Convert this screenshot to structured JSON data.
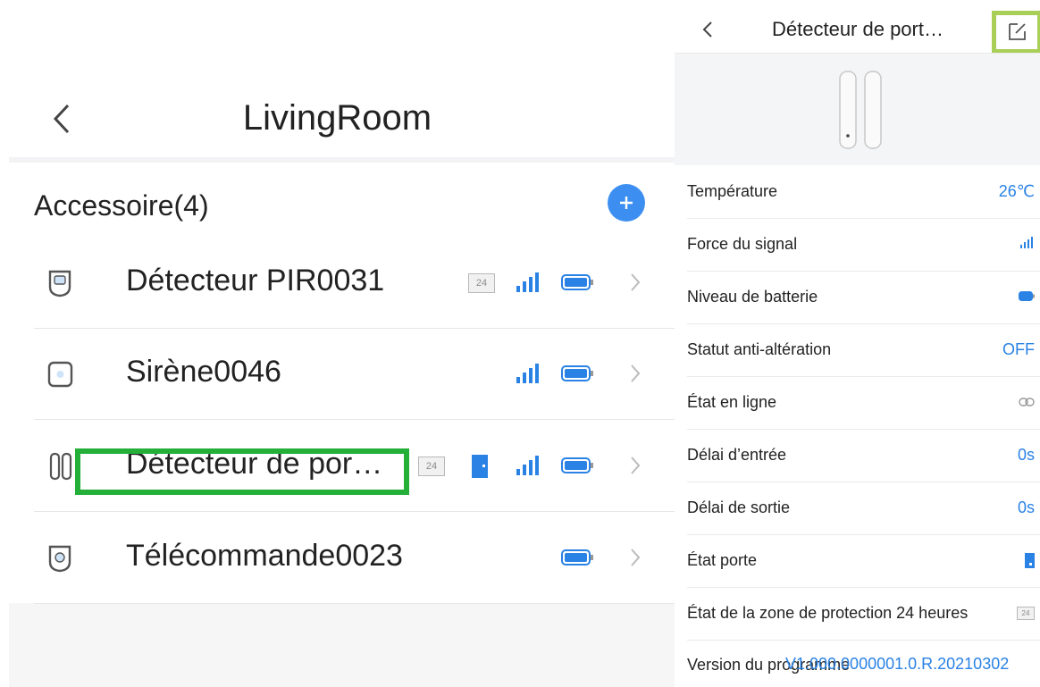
{
  "left": {
    "title": "LivingRoom",
    "section_title": "Accessoire(4)",
    "add_label": "+",
    "devices": [
      {
        "name": "Détecteur PIR0031",
        "icon": "pir-sensor-icon",
        "badge": "24",
        "signal": true,
        "battery": true
      },
      {
        "name": "Sirène0046",
        "icon": "siren-icon",
        "signal": true,
        "battery": true
      },
      {
        "name": "Détecteur de por…",
        "icon": "door-sensor-icon",
        "badge": "24",
        "door": true,
        "signal": true,
        "battery": true
      },
      {
        "name": "Télécommande0023",
        "icon": "remote-icon",
        "battery": true
      }
    ]
  },
  "right": {
    "title": "Détecteur de port…",
    "properties": [
      {
        "label": "Température",
        "value": "26℃"
      },
      {
        "label": "Force du signal",
        "icon": "signal-icon"
      },
      {
        "label": "Niveau de batterie",
        "icon": "battery-icon"
      },
      {
        "label": "Statut anti-altération",
        "value": "OFF"
      },
      {
        "label": "État en ligne",
        "icon": "link-icon"
      },
      {
        "label": "Délai d’entrée",
        "value": "0s"
      },
      {
        "label": "Délai de sortie",
        "value": "0s"
      },
      {
        "label": "État porte",
        "icon": "door-icon"
      },
      {
        "label": "État de la zone de protection 24 heures",
        "value": "24"
      }
    ],
    "version": {
      "label": "Version du programme",
      "value": "V1.000.0000001.0.R.20210302"
    }
  },
  "colors": {
    "accent": "#2a82e4",
    "add_button": "#3c8ff0",
    "highlight_green": "#24b038",
    "edit_box_green": "#a9cf59"
  }
}
